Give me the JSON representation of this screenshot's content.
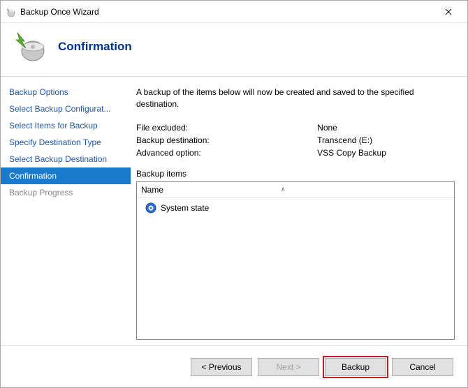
{
  "window": {
    "title": "Backup Once Wizard"
  },
  "header": {
    "title": "Confirmation"
  },
  "sidebar": {
    "items": [
      {
        "label": "Backup Options",
        "state": "normal"
      },
      {
        "label": "Select Backup Configurat...",
        "state": "normal"
      },
      {
        "label": "Select Items for Backup",
        "state": "normal"
      },
      {
        "label": "Specify Destination Type",
        "state": "normal"
      },
      {
        "label": "Select Backup Destination",
        "state": "normal"
      },
      {
        "label": "Confirmation",
        "state": "selected"
      },
      {
        "label": "Backup Progress",
        "state": "disabled"
      }
    ]
  },
  "main": {
    "description": "A backup of the items below will now be created and saved to the specified destination.",
    "info": [
      {
        "label": "File excluded:",
        "value": "None"
      },
      {
        "label": "Backup destination:",
        "value": "Transcend (E:)"
      },
      {
        "label": "Advanced option:",
        "value": "VSS Copy Backup"
      }
    ],
    "items_label": "Backup items",
    "items_header": "Name",
    "items": [
      {
        "label": "System state"
      }
    ]
  },
  "footer": {
    "previous": "< Previous",
    "next": "Next >",
    "backup": "Backup",
    "cancel": "Cancel"
  }
}
